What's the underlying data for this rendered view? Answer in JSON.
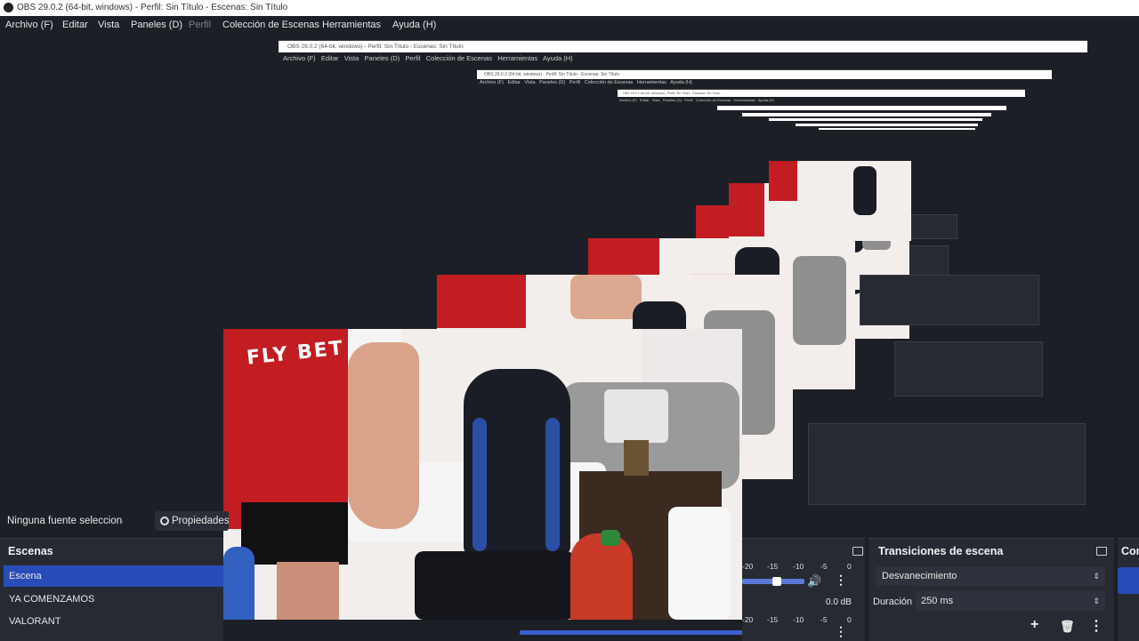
{
  "window": {
    "title": "OBS 29.0.2 (64-bit, windows) - Perfil: Sin Título - Escenas: Sin Título"
  },
  "menu": {
    "archivo": "Archivo (F)",
    "editar": "Editar",
    "vista": "Vista",
    "paneles": "Paneles (D)",
    "perfil": "Perfil",
    "coleccion": "Colección de Escenas",
    "herramientas": "Herramientas",
    "ayuda": "Ayuda (H)"
  },
  "mirror": {
    "title": "OBS 29.0.2 (64-bit, windows) - Perfil: Sin Título - Escenas: Sin Título",
    "menu": "Archivo (F)   Editar   Vista   Paneles (D)   Perfil   Colección de Escenas   Herramientas   Ayuda (H)"
  },
  "webcam": {
    "shirt_text": "FLY BET"
  },
  "sources_bar": {
    "no_source": "Ninguna fuente seleccionada",
    "properties": "Propiedades"
  },
  "scenes": {
    "header": "Escenas",
    "items": [
      "Escena",
      "YA COMENZAMOS",
      "VALORANT"
    ],
    "selected": 0
  },
  "mixer": {
    "scale": [
      "-20",
      "-15",
      "-10",
      "-5",
      "0"
    ],
    "db": "0.0 dB"
  },
  "transitions": {
    "header": "Transiciones de escena",
    "type": "Desvanecimiento",
    "duration_label": "Duración",
    "duration_value": "250 ms"
  },
  "controls": {
    "header": "Controles"
  },
  "colors": {
    "accent": "#284cb8",
    "panel": "#272a33",
    "background": "#1d1f26"
  }
}
